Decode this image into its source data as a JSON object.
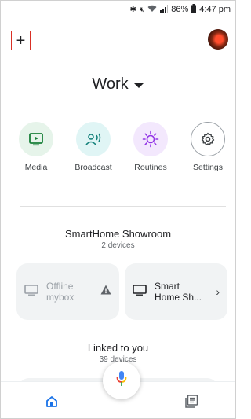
{
  "status_bar": {
    "battery": "86%",
    "time": "4:47 pm"
  },
  "header": {
    "title": "Work"
  },
  "quick_actions": [
    {
      "label": "Media",
      "color": "#e6f4ea",
      "icon": "media-icon"
    },
    {
      "label": "Broadcast",
      "color": "#e0f5f5",
      "icon": "broadcast-icon"
    },
    {
      "label": "Routines",
      "color": "#f3e8fd",
      "icon": "routines-icon"
    },
    {
      "label": "Settings",
      "color": "#ffffff",
      "icon": "gear-icon"
    }
  ],
  "room": {
    "name": "SmartHome Showroom",
    "device_count": "2 devices",
    "devices": [
      {
        "name_line1": "Offline",
        "name_line2": "mybox",
        "status": "offline"
      },
      {
        "name_line1": "Smart",
        "name_line2": "Home Sh...",
        "status": "online"
      }
    ]
  },
  "linked": {
    "title": "Linked to you",
    "count": "39 devices"
  },
  "colors": {
    "accent_blue": "#1a73e8",
    "mic_red": "#ea4335",
    "mic_yellow": "#fbbc04",
    "mic_green": "#34a853",
    "highlight_red": "#d93025"
  }
}
